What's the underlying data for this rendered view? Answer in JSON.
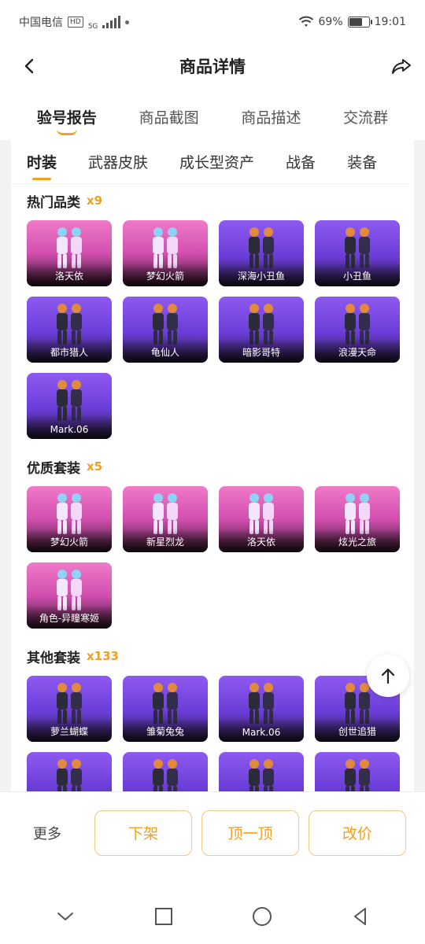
{
  "status_bar": {
    "carrier": "中国电信",
    "hd": "HD",
    "network": "5G",
    "battery_percent": "69%",
    "battery_level": 0.69,
    "time": "19:01"
  },
  "nav": {
    "title": "商品详情",
    "back_icon": "chevron-left-icon",
    "share_icon": "share-icon"
  },
  "main_tabs": [
    {
      "label": "验号报告",
      "active": true
    },
    {
      "label": "商品截图",
      "active": false
    },
    {
      "label": "商品描述",
      "active": false
    },
    {
      "label": "交流群",
      "active": false
    }
  ],
  "sub_tabs": [
    {
      "label": "时装",
      "active": true
    },
    {
      "label": "武器皮肤",
      "active": false
    },
    {
      "label": "成长型资产",
      "active": false
    },
    {
      "label": "战备",
      "active": false
    },
    {
      "label": "装备",
      "active": false
    }
  ],
  "sections": [
    {
      "title": "热门品类",
      "count": "x9",
      "items": [
        {
          "name": "洛天依",
          "theme": "pink"
        },
        {
          "name": "梦幻火箭",
          "theme": "pink"
        },
        {
          "name": "深海小丑鱼",
          "theme": "purple"
        },
        {
          "name": "小丑鱼",
          "theme": "purple"
        },
        {
          "name": "都市猎人",
          "theme": "purple"
        },
        {
          "name": "龟仙人",
          "theme": "purple"
        },
        {
          "name": "暗影哥特",
          "theme": "purple"
        },
        {
          "name": "浪漫天命",
          "theme": "purple"
        },
        {
          "name": "Mark.06",
          "theme": "purple"
        }
      ]
    },
    {
      "title": "优质套装",
      "count": "x5",
      "items": [
        {
          "name": "梦幻火箭",
          "theme": "pink"
        },
        {
          "name": "新星烈龙",
          "theme": "pink"
        },
        {
          "name": "洛天依",
          "theme": "pink"
        },
        {
          "name": "炫光之旅",
          "theme": "pink"
        },
        {
          "name": "角色-异瞳寒姬",
          "theme": "pink"
        }
      ]
    },
    {
      "title": "其他套装",
      "count": "x133",
      "items": [
        {
          "name": "萝兰蝴蝶",
          "theme": "purple"
        },
        {
          "name": "雏菊兔兔",
          "theme": "purple"
        },
        {
          "name": "Mark.06",
          "theme": "purple"
        },
        {
          "name": "创世追猎",
          "theme": "purple"
        },
        {
          "name": "",
          "theme": "purple"
        },
        {
          "name": "",
          "theme": "purple"
        },
        {
          "name": "",
          "theme": "purple"
        },
        {
          "name": "",
          "theme": "purple"
        }
      ]
    }
  ],
  "actions": {
    "more": "更多",
    "delist": "下架",
    "bump": "顶一顶",
    "reprice": "改价"
  },
  "colors": {
    "accent": "#f0a020",
    "card_purple": "#7a4ae8",
    "card_pink": "#e061bd"
  }
}
